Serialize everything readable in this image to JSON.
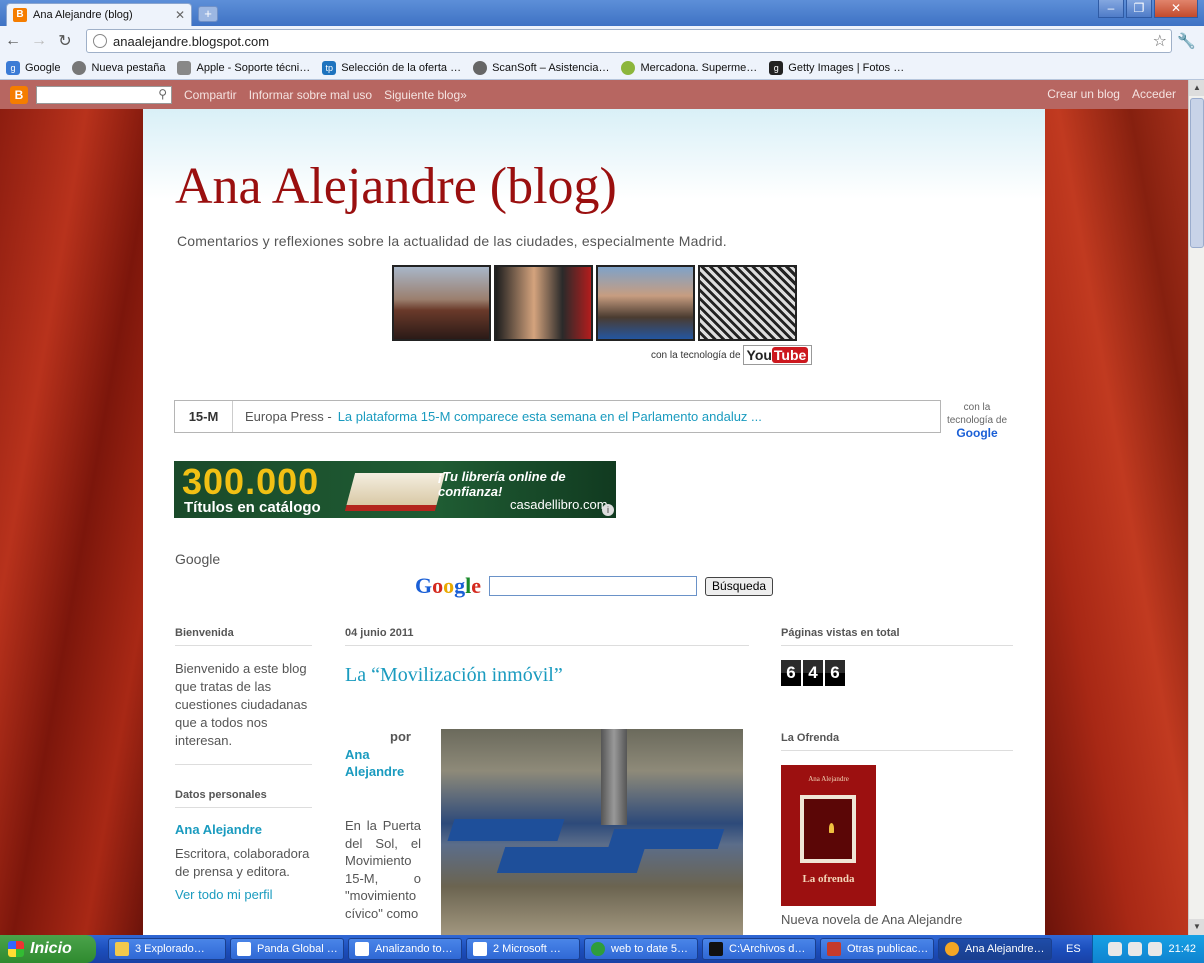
{
  "browser": {
    "tab_title": "Ana Alejandre (blog)",
    "url": "anaalejandre.blogspot.com",
    "bookmarks": [
      {
        "label": "Google",
        "color": "#3b7bd5"
      },
      {
        "label": "Nueva pestaña",
        "color": "#777777"
      },
      {
        "label": "Apple - Soporte técni…",
        "color": "#888888"
      },
      {
        "label": "Selección de la oferta …",
        "color": "#1e73be"
      },
      {
        "label": "ScanSoft – Asistencia…",
        "color": "#666666"
      },
      {
        "label": "Mercadona. Superme…",
        "color": "#8cb63c"
      },
      {
        "label": "Getty Images | Fotos …",
        "color": "#222222"
      }
    ]
  },
  "blogger_bar": {
    "links": [
      "Compartir",
      "Informar sobre mal uso",
      "Siguiente blog»"
    ],
    "right_links": [
      "Crear un blog",
      "Acceder"
    ]
  },
  "blog": {
    "title": "Ana Alejandre (blog)",
    "description": "Comentarios y reflexiones sobre la actualidad de las ciudades, especialmente Madrid.",
    "youtube_credit": "con la tecnología de",
    "youtube_you": "You",
    "youtube_tube": "Tube"
  },
  "news": {
    "tag": "15-M",
    "source": "Europa Press -",
    "headline": "La plataforma 15-M comparece esta semana en el Parlamento andaluz ...",
    "powered_1": "con la",
    "powered_2": "tecnología de",
    "powered_google": "Google"
  },
  "banner": {
    "number": "300.000",
    "subtitle": "Títulos en catálogo",
    "slogan": "¡Tu librería online de confianza!",
    "brand": "casadellibro.com",
    "info": "i"
  },
  "google_search": {
    "title": "Google",
    "button": "Búsqueda"
  },
  "left_sidebar": {
    "welcome_title": "Bienvenida",
    "welcome_text": "Bienvenido a este blog que tratas de las cuestiones ciudadanas que a todos nos interesan.",
    "personal_title": "Datos personales",
    "name": "Ana Alejandre",
    "bio": "Escritora, colaboradora de prensa y editora.",
    "profile_link": "Ver todo mi perfil"
  },
  "post": {
    "date": "04 junio 2011",
    "title": "La “Movilización inmóvil”",
    "by": "por",
    "author": "Ana Alejandre",
    "body": "En la Puerta del Sol, el Movimiento 15-M, o \"movimiento cívico\" como"
  },
  "right_sidebar": {
    "views_title": "Páginas vistas en total",
    "view_digits": [
      "6",
      "4",
      "6"
    ],
    "book_title_header": "La Ofrenda",
    "book_author": "Ana Alejandre",
    "book_cover_title": "La ofrenda",
    "book_caption": "Nueva novela de Ana Alejandre"
  },
  "taskbar": {
    "start": "Inicio",
    "tasks": [
      {
        "label": "3 Explorado…",
        "color": "#f2c94c"
      },
      {
        "label": "Panda Global …",
        "color": "#ffffff"
      },
      {
        "label": "Analizando to…",
        "color": "#ffffff"
      },
      {
        "label": "2 Microsoft …",
        "color": "#ffffff"
      },
      {
        "label": "web to date 5…",
        "color": "#2e9d3c"
      },
      {
        "label": "C:\\Archivos d…",
        "color": "#111111"
      },
      {
        "label": "Otras publicac…",
        "color": "#c53b2b"
      },
      {
        "label": "Ana Alejandre…",
        "color": "#f5a623"
      }
    ],
    "lang": "ES",
    "time": "21:42"
  }
}
